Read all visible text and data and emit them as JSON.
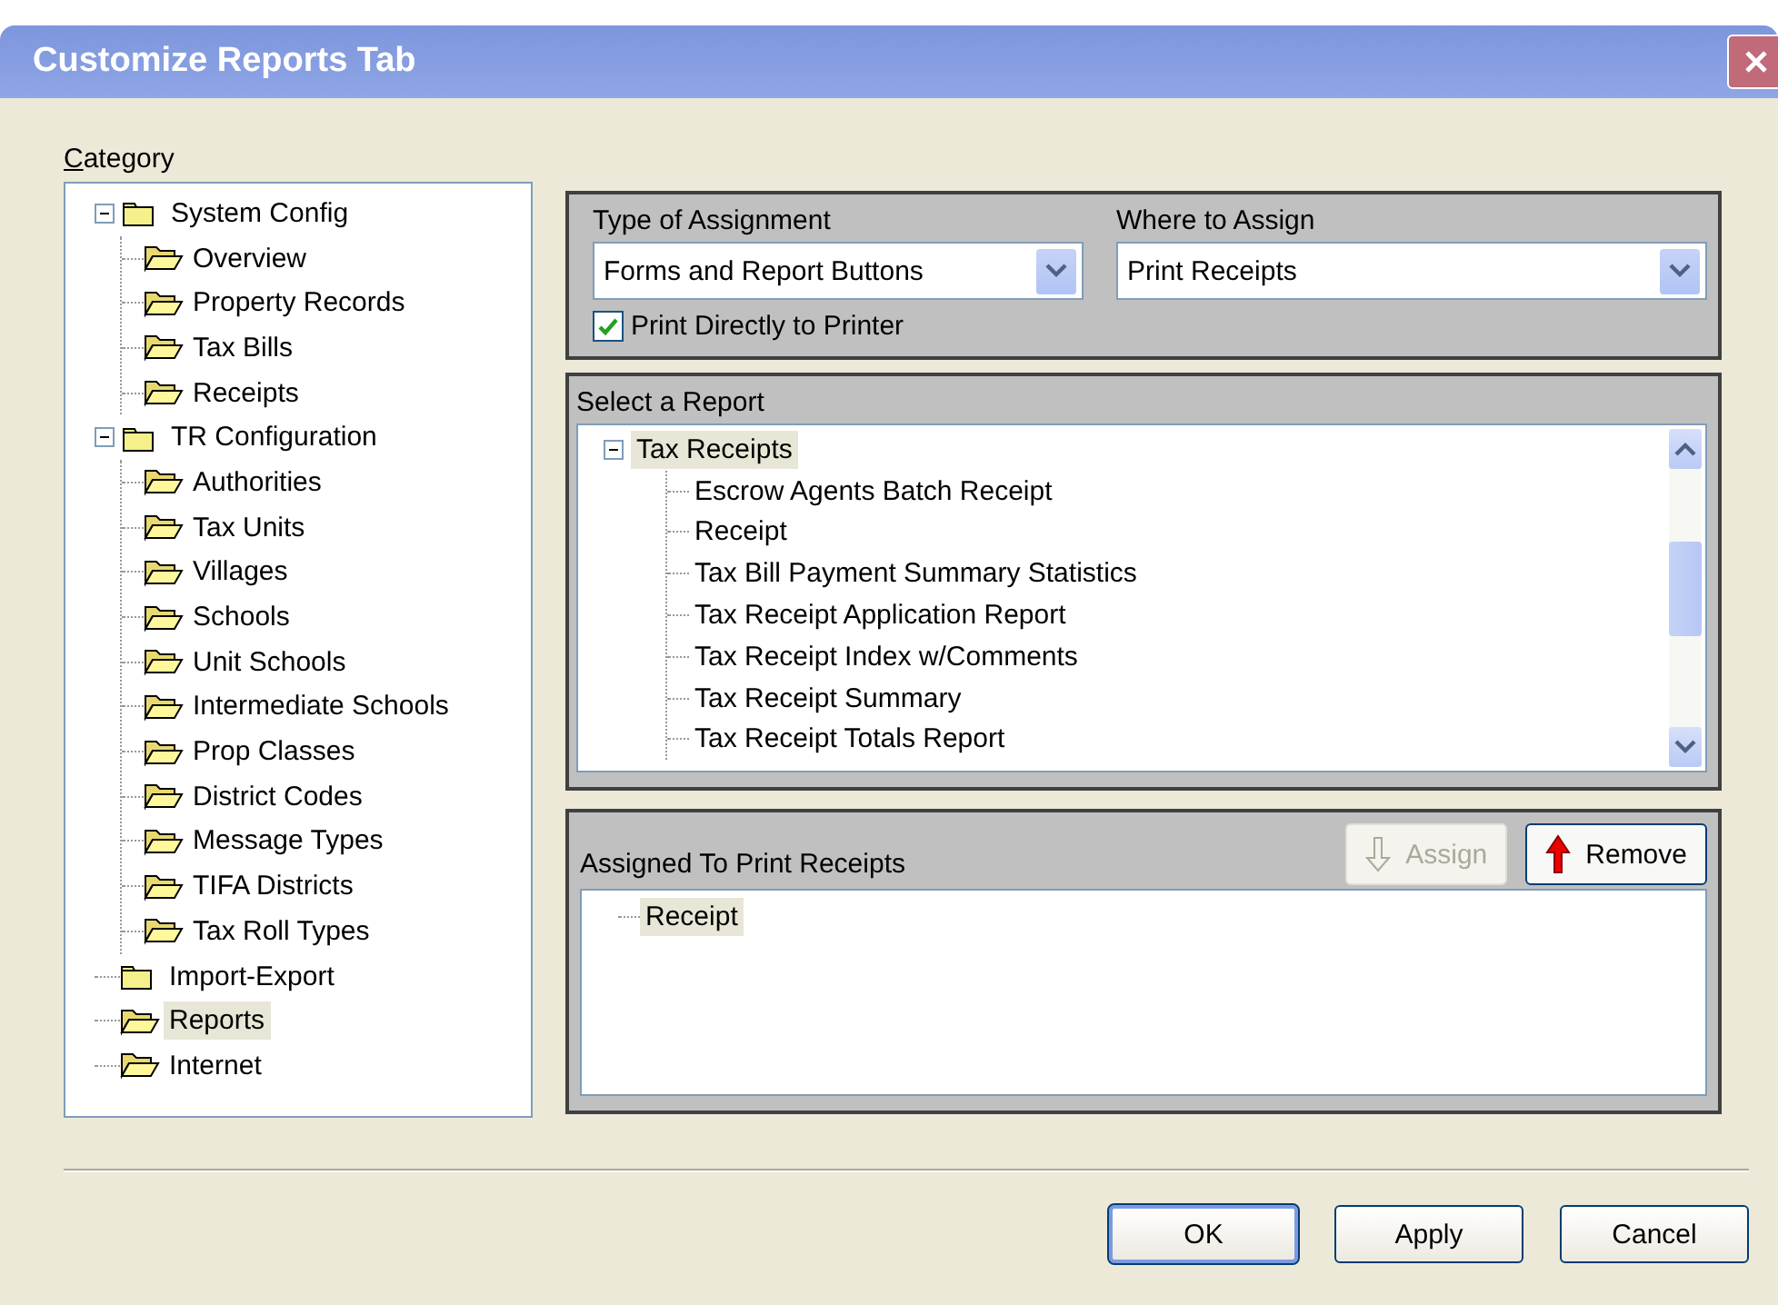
{
  "window": {
    "title": "Customize Reports Tab"
  },
  "category": {
    "label": "Category",
    "items": [
      {
        "label": "System Config",
        "open": false,
        "expanded": true,
        "selected": false,
        "children": [
          {
            "label": "Overview",
            "open": true,
            "selected": false
          },
          {
            "label": "Property Records",
            "open": true,
            "selected": false
          },
          {
            "label": "Tax Bills",
            "open": true,
            "selected": false
          },
          {
            "label": "Receipts",
            "open": true,
            "selected": false
          }
        ]
      },
      {
        "label": "TR Configuration",
        "open": false,
        "expanded": true,
        "selected": false,
        "children": [
          {
            "label": "Authorities",
            "open": true,
            "selected": false
          },
          {
            "label": "Tax Units",
            "open": true,
            "selected": false
          },
          {
            "label": "Villages",
            "open": true,
            "selected": false
          },
          {
            "label": "Schools",
            "open": true,
            "selected": false
          },
          {
            "label": "Unit Schools",
            "open": true,
            "selected": false
          },
          {
            "label": "Intermediate Schools",
            "open": true,
            "selected": false
          },
          {
            "label": "Prop Classes",
            "open": true,
            "selected": false
          },
          {
            "label": "District Codes",
            "open": true,
            "selected": false
          },
          {
            "label": "Message Types",
            "open": true,
            "selected": false
          },
          {
            "label": "TIFA Districts",
            "open": true,
            "selected": false
          },
          {
            "label": "Tax Roll Types",
            "open": true,
            "selected": false
          }
        ]
      },
      {
        "label": "Import-Export",
        "open": false,
        "selected": false
      },
      {
        "label": "Reports",
        "open": true,
        "selected": true
      },
      {
        "label": "Internet",
        "open": true,
        "selected": false
      }
    ]
  },
  "assignment": {
    "type_label": "Type of Assignment",
    "type_value": "Forms and Report Buttons",
    "where_label": "Where to Assign",
    "where_value": "Print Receipts",
    "print_directly": {
      "label": "Print Directly to Printer",
      "checked": true
    }
  },
  "report_list": {
    "label": "Select a Report",
    "items": [
      {
        "label": "Tax Receipts",
        "expanded": true,
        "selected": true,
        "children": [
          {
            "label": "Escrow Agents Batch Receipt",
            "selected": false
          },
          {
            "label": "Receipt",
            "selected": false
          },
          {
            "label": "Tax Bill Payment Summary Statistics",
            "selected": false
          },
          {
            "label": "Tax Receipt Application Report",
            "selected": false
          },
          {
            "label": "Tax Receipt Index w/Comments",
            "selected": false
          },
          {
            "label": "Tax Receipt Summary",
            "selected": false
          },
          {
            "label": "Tax Receipt Totals Report",
            "selected": false
          }
        ]
      }
    ]
  },
  "assigned": {
    "label": "Assigned To Print Receipts",
    "items": [
      {
        "label": "Receipt",
        "selected": true
      }
    ],
    "buttons": [
      {
        "label": "Assign",
        "kind": "assign",
        "disabled": true
      },
      {
        "label": "Remove",
        "kind": "remove",
        "disabled": false
      }
    ]
  },
  "buttons": [
    {
      "label": "OK",
      "default": true
    },
    {
      "label": "Apply",
      "default": false
    },
    {
      "label": "Cancel",
      "default": false
    }
  ]
}
